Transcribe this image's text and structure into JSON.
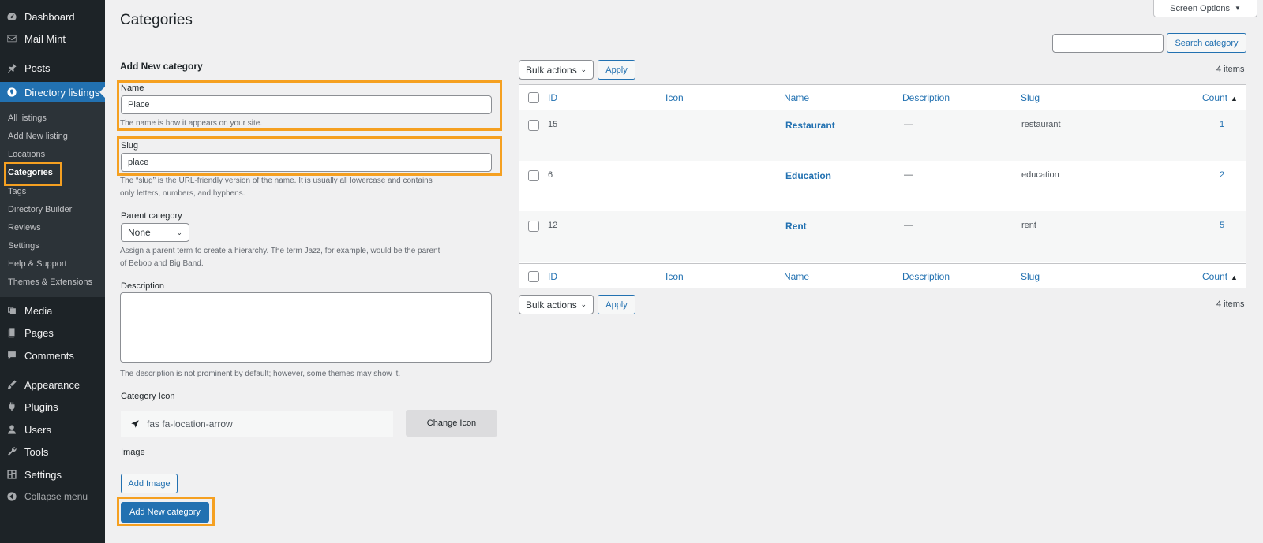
{
  "sidebar": {
    "top_items": [
      {
        "label": "Dashboard",
        "icon": "dashboard-icon"
      },
      {
        "label": "Mail Mint",
        "icon": "mail-icon"
      },
      {
        "label": "Posts",
        "icon": "pin-icon"
      },
      {
        "label": "Directory listings",
        "icon": "map-pin-icon"
      }
    ],
    "sub_items": [
      "All listings",
      "Add New listing",
      "Locations",
      "Categories",
      "Tags",
      "Directory Builder",
      "Reviews",
      "Settings",
      "Help & Support",
      "Themes & Extensions"
    ],
    "bottom_items": [
      {
        "label": "Media",
        "icon": "media-icon"
      },
      {
        "label": "Pages",
        "icon": "pages-icon"
      },
      {
        "label": "Comments",
        "icon": "comments-icon"
      },
      {
        "label": "Appearance",
        "icon": "brush-icon"
      },
      {
        "label": "Plugins",
        "icon": "plug-icon"
      },
      {
        "label": "Users",
        "icon": "user-icon"
      },
      {
        "label": "Tools",
        "icon": "wrench-icon"
      },
      {
        "label": "Settings",
        "icon": "settings-icon"
      },
      {
        "label": "Collapse menu",
        "icon": "collapse-icon"
      }
    ]
  },
  "header": {
    "title": "Categories",
    "screen_options": "Screen Options",
    "search_button": "Search category",
    "search_value": ""
  },
  "form": {
    "title": "Add New category",
    "name_label": "Name",
    "name_value": "Place",
    "name_help": "The name is how it appears on your site.",
    "slug_label": "Slug",
    "slug_value": "place",
    "slug_help_1": "The “slug” is the URL-friendly version of the name. It is usually all lowercase and contains",
    "slug_help_2": "only letters, numbers, and hyphens.",
    "parent_label": "Parent category",
    "parent_value": "None",
    "parent_help_1": "Assign a parent term to create a hierarchy. The term Jazz, for example, would be the parent",
    "parent_help_2": "of Bebop and Big Band.",
    "description_label": "Description",
    "description_help": "The description is not prominent by default; however, some themes may show it.",
    "icon_label": "Category Icon",
    "icon_value": "fas fa-location-arrow",
    "change_icon": "Change Icon",
    "image_label": "Image",
    "add_image": "Add Image",
    "submit": "Add New category"
  },
  "table": {
    "bulk_actions": "Bulk actions",
    "apply": "Apply",
    "items_count": "4 items",
    "columns": {
      "id": "ID",
      "icon": "Icon",
      "name": "Name",
      "description": "Description",
      "slug": "Slug",
      "count": "Count"
    },
    "rows": [
      {
        "id": "15",
        "name": "Restaurant",
        "description": "—",
        "slug": "restaurant",
        "count": "1"
      },
      {
        "id": "6",
        "name": "Education",
        "description": "—",
        "slug": "education",
        "count": "2"
      },
      {
        "id": "12",
        "name": "Rent",
        "description": "—",
        "slug": "rent",
        "count": "5"
      }
    ]
  },
  "colors": {
    "accent": "#2271b1",
    "sidebar": "#1d2327",
    "highlight": "#f5a021"
  }
}
